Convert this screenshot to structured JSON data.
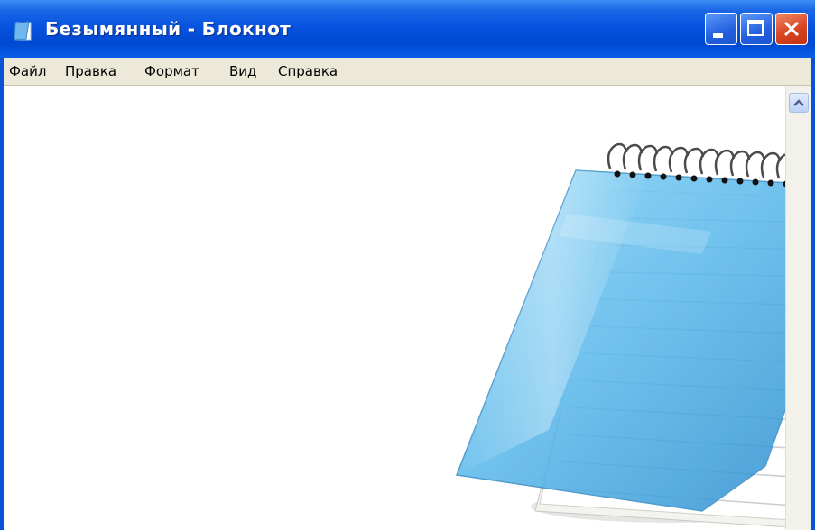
{
  "window": {
    "title": "Безымянный - Блокнот",
    "icon": "notepad-icon"
  },
  "controls": {
    "minimize_icon": "minimize-icon",
    "maximize_icon": "maximize-icon",
    "close_icon": "close-icon"
  },
  "menu": {
    "items": [
      {
        "label": "Файл"
      },
      {
        "label": "Правка"
      },
      {
        "label": "Формат"
      },
      {
        "label": "Вид"
      },
      {
        "label": "Справка"
      }
    ]
  },
  "editor": {
    "text": ""
  },
  "scrollbar": {
    "up_icon": "chevron-up-icon"
  },
  "colors": {
    "titlebar": "#0854e0",
    "close_button": "#d8451f",
    "menubar": "#ece9d8",
    "editor_bg": "#ffffff"
  }
}
